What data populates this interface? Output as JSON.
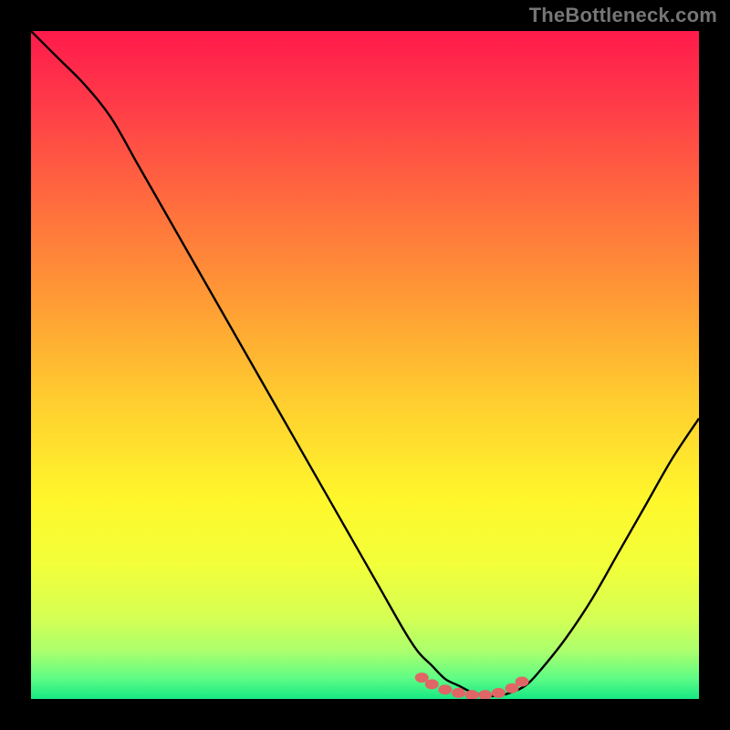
{
  "watermark": "TheBottleneck.com",
  "chart_data": {
    "type": "line",
    "title": "",
    "xlabel": "",
    "ylabel": "",
    "xlim": [
      0,
      100
    ],
    "ylim": [
      0,
      100
    ],
    "grid": false,
    "series": [
      {
        "name": "curve",
        "color": "#000000",
        "x": [
          0,
          4,
          8,
          12,
          16,
          20,
          24,
          28,
          32,
          36,
          40,
          44,
          48,
          52,
          56,
          58,
          60,
          62,
          64,
          66,
          68,
          70,
          72,
          74,
          76,
          80,
          84,
          88,
          92,
          96,
          100
        ],
        "y": [
          100,
          96,
          92,
          87,
          80,
          73,
          66,
          59,
          52,
          45,
          38,
          31,
          24,
          17,
          10,
          7,
          5,
          3,
          2,
          1,
          0.5,
          0.5,
          1,
          2,
          4,
          9,
          15,
          22,
          29,
          36,
          42
        ]
      }
    ],
    "markers": {
      "color": "#e06666",
      "points_x": [
        58.5,
        60,
        62,
        64,
        66,
        68,
        70,
        72,
        73.5
      ],
      "points_y": [
        3.2,
        2.2,
        1.4,
        0.9,
        0.6,
        0.6,
        0.9,
        1.6,
        2.6
      ]
    },
    "gradient_stops": [
      {
        "offset": 0.0,
        "color": "#ff1a4b"
      },
      {
        "offset": 0.1,
        "color": "#ff3849"
      },
      {
        "offset": 0.25,
        "color": "#ff6a3e"
      },
      {
        "offset": 0.4,
        "color": "#ff9a35"
      },
      {
        "offset": 0.55,
        "color": "#ffcc2f"
      },
      {
        "offset": 0.7,
        "color": "#fff72c"
      },
      {
        "offset": 0.8,
        "color": "#f2ff3a"
      },
      {
        "offset": 0.88,
        "color": "#d4ff54"
      },
      {
        "offset": 0.93,
        "color": "#a9ff6e"
      },
      {
        "offset": 0.97,
        "color": "#5cfc86"
      },
      {
        "offset": 1.0,
        "color": "#17e884"
      }
    ]
  }
}
